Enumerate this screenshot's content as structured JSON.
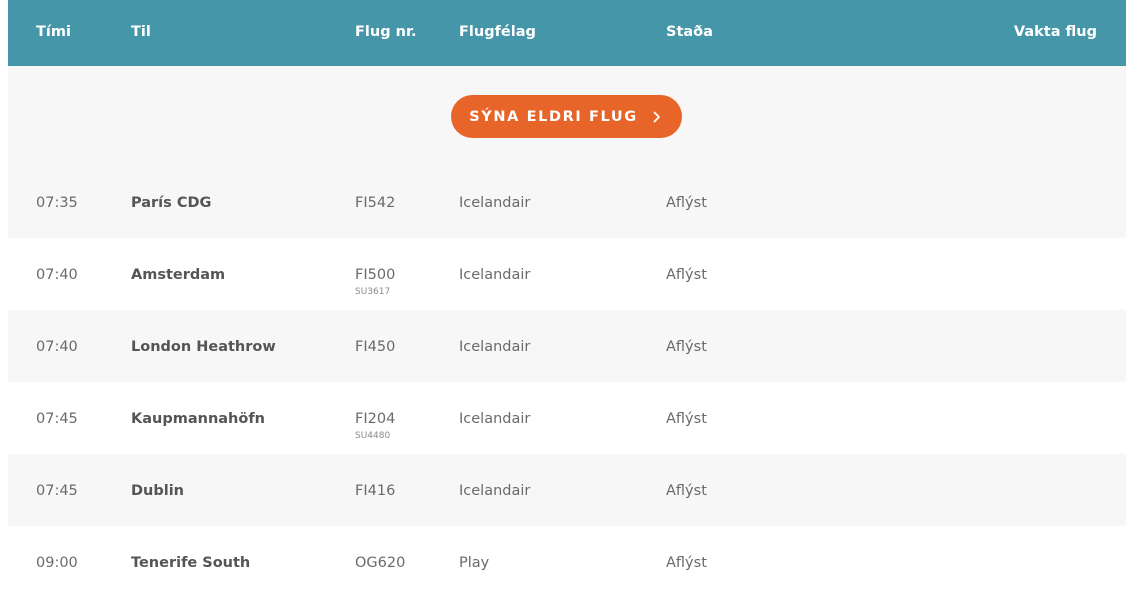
{
  "header": {
    "time": "Tími",
    "destination": "Til",
    "flight_no": "Flug nr.",
    "airline": "Flugfélag",
    "status": "Staða",
    "watch": "Vakta flug"
  },
  "older_button": {
    "label": "SÝNA ELDRI FLUG",
    "icon": "chevron-right-icon",
    "color": "#e8652a"
  },
  "colors": {
    "header_bg": "#4696a9",
    "row_alt_bg": "#f7f7f7"
  },
  "flights": [
    {
      "time": "07:35",
      "destination": "París CDG",
      "flight": "FI542",
      "codeshare": "",
      "airline": "Icelandair",
      "status": "Aflýst"
    },
    {
      "time": "07:40",
      "destination": "Amsterdam",
      "flight": "FI500",
      "codeshare": "SU3617",
      "airline": "Icelandair",
      "status": "Aflýst"
    },
    {
      "time": "07:40",
      "destination": "London Heathrow",
      "flight": "FI450",
      "codeshare": "",
      "airline": "Icelandair",
      "status": "Aflýst"
    },
    {
      "time": "07:45",
      "destination": "Kaupmannahöfn",
      "flight": "FI204",
      "codeshare": "SU4480",
      "airline": "Icelandair",
      "status": "Aflýst"
    },
    {
      "time": "07:45",
      "destination": "Dublin",
      "flight": "FI416",
      "codeshare": "",
      "airline": "Icelandair",
      "status": "Aflýst"
    },
    {
      "time": "09:00",
      "destination": "Tenerife South",
      "flight": "OG620",
      "codeshare": "",
      "airline": "Play",
      "status": "Aflýst"
    }
  ]
}
